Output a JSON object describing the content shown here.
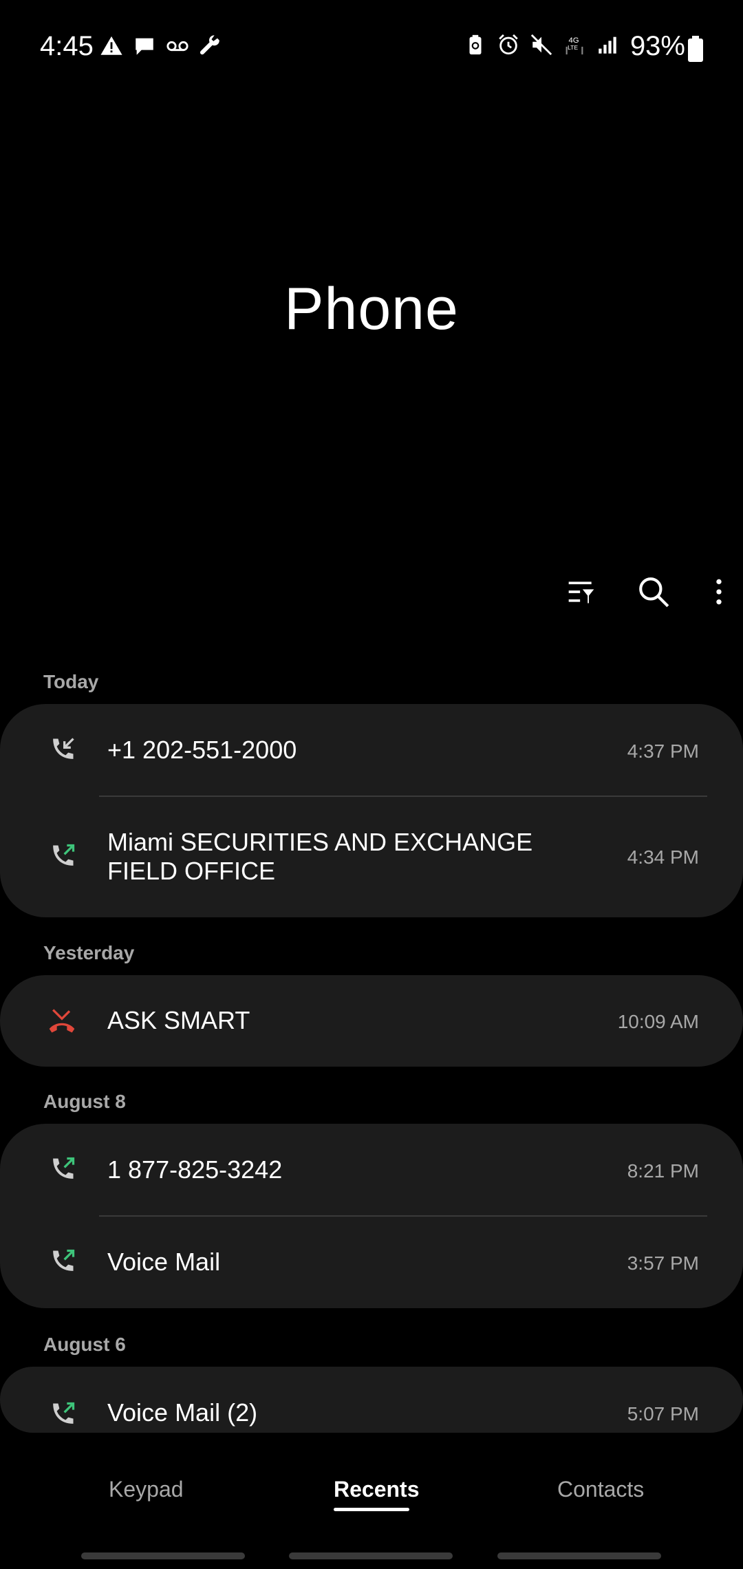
{
  "status_bar": {
    "time": "4:45",
    "left_icons": [
      "warning-icon",
      "message-icon",
      "voicemail-icon",
      "wrench-icon"
    ],
    "right_icons": [
      "battery-saver-icon",
      "alarm-icon",
      "mute-icon",
      "4g-lte-icon",
      "signal-icon"
    ],
    "battery_percent": "93%"
  },
  "app": {
    "title": "Phone"
  },
  "toolbar": {
    "icons": [
      "filter-icon",
      "search-icon",
      "more-icon"
    ]
  },
  "sections": [
    {
      "header": "Today",
      "calls": [
        {
          "name": "+1 202-551-2000",
          "time": "4:37 PM",
          "type": "incoming"
        },
        {
          "name": "Miami SECURITIES AND EXCHANGE FIELD OFFICE",
          "time": "4:34 PM",
          "type": "outgoing"
        }
      ]
    },
    {
      "header": "Yesterday",
      "calls": [
        {
          "name": "ASK SMART",
          "time": "10:09 AM",
          "type": "missed"
        }
      ]
    },
    {
      "header": "August 8",
      "calls": [
        {
          "name": "1 877-825-3242",
          "time": "8:21 PM",
          "type": "outgoing"
        },
        {
          "name": "Voice Mail",
          "time": "3:57 PM",
          "type": "outgoing"
        }
      ]
    },
    {
      "header": "August 6",
      "calls": [
        {
          "name": "Voice Mail (2)",
          "time": "5:07 PM",
          "type": "outgoing"
        }
      ]
    }
  ],
  "bottom_nav": {
    "tabs": [
      {
        "label": "Keypad"
      },
      {
        "label": "Recents"
      },
      {
        "label": "Contacts"
      }
    ],
    "active": "Recents"
  },
  "colors": {
    "background": "#000000",
    "card": "#1c1c1c",
    "secondary_text": "#a8a8a8",
    "outgoing_arrow": "#3ec47a",
    "missed": "#e0473a"
  }
}
